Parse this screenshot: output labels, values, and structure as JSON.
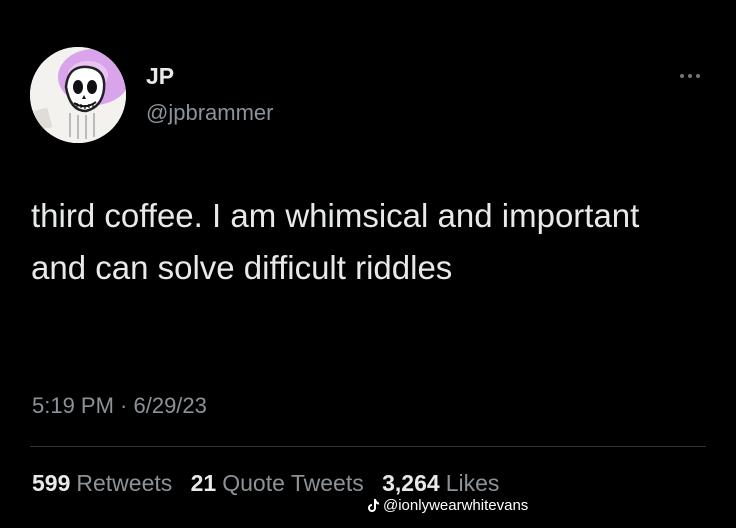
{
  "colors": {
    "background": "#000000",
    "primary_text": "#e7e9ea",
    "secondary_text": "#8b9298",
    "divider": "#2f3336",
    "avatar_accent": "#d9a4ea"
  },
  "author": {
    "display_name": "JP",
    "handle": "@jpbrammer",
    "avatar_icon": "skeleton-avatar-icon"
  },
  "menu": {
    "icon": "more-icon"
  },
  "tweet": {
    "text": "third coffee. I am whimsical and important and can solve difficult riddles",
    "timestamp": "5:19 PM · 6/29/23"
  },
  "stats": [
    {
      "count": "599",
      "label": "Retweets"
    },
    {
      "count": "21",
      "label": "Quote Tweets"
    },
    {
      "count": "3,264",
      "label": "Likes"
    }
  ],
  "watermark": {
    "icon": "tiktok-icon",
    "text": "@ionlywearwhitevans"
  }
}
